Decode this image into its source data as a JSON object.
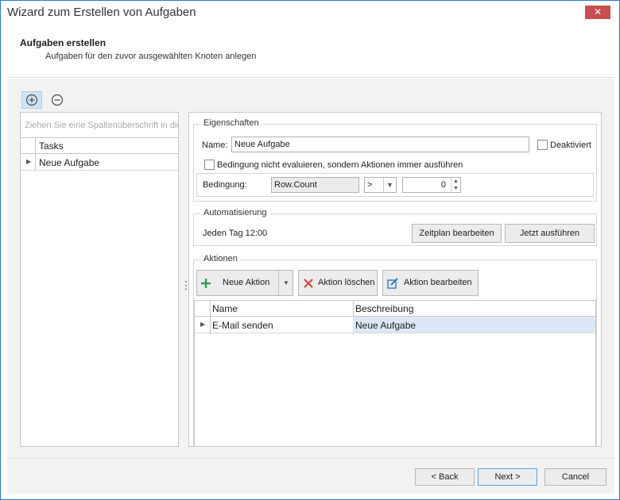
{
  "window": {
    "title": "Wizard zum Erstellen von Aufgaben",
    "close_glyph": "✕"
  },
  "header": {
    "title": "Aufgaben erstellen",
    "subtitle": "Aufgaben für den zuvor ausgewählten Knoten anlegen"
  },
  "toolbar": {
    "add_icon": "plus-circle-icon",
    "remove_icon": "minus-circle-icon"
  },
  "task_list": {
    "group_placeholder": "Ziehen Sie eine Spaltenüberschrift in die",
    "column_header": "Tasks",
    "rows": [
      {
        "name": "Neue Aufgabe"
      }
    ]
  },
  "properties": {
    "legend": "Eigenschaften",
    "name_label": "Name:",
    "name_value": "Neue Aufgabe",
    "deactivated_label": "Deaktiviert",
    "deactivated_checked": false,
    "skip_condition_label": "Bedingung nicht evaluieren, sondern Aktionen immer ausführen",
    "skip_condition_checked": false,
    "condition_label": "Bedingung:",
    "condition_field": "Row.Count",
    "operator": ">",
    "condition_value": "0"
  },
  "automation": {
    "legend": "Automatisierung",
    "schedule_text": "Jeden Tag  12:00",
    "edit_schedule_button": "Zeitplan bearbeiten",
    "run_now_button": "Jetzt ausführen"
  },
  "actions": {
    "legend": "Aktionen",
    "new_action_button": "Neue Aktion",
    "delete_action_button": "Aktion löschen",
    "edit_action_button": "Aktion bearbeiten",
    "columns": [
      "Name",
      "Beschreibung"
    ],
    "rows": [
      {
        "name": "E-Mail senden",
        "description": "Neue Aufgabe"
      }
    ]
  },
  "footer": {
    "back_button": "< Back",
    "next_button": "Next >",
    "cancel_button": "Cancel"
  },
  "colors": {
    "accent_border": "#2b79d6",
    "close_button": "#c84f4f",
    "selected_row": "#dce8f5",
    "add_icon": "#2e9e4e",
    "delete_icon": "#d9433b",
    "edit_icon": "#2b79d6"
  }
}
